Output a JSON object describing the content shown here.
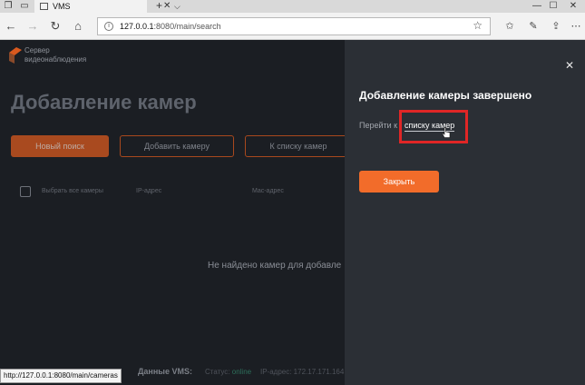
{
  "browser": {
    "tab_title": "VMS",
    "url_host": "127.0.0.1",
    "url_rest": ":8080/main/search",
    "status_url": "http://127.0.0.1:8080/main/cameras"
  },
  "app": {
    "logo_line1": "Сервер",
    "logo_line2": "видеонаблюдения",
    "page_title": "Добавление камер",
    "buttons": {
      "new_search": "Новый поиск",
      "add_camera": "Добавить камеру",
      "to_list": "К списку камер"
    },
    "table": {
      "select_all": "Выбрать все камеры",
      "col_ip": "IP-адрес",
      "col_mac": "Mac-адрес"
    },
    "empty_message": "Не найдено камер для добавле",
    "footer": {
      "label": "Данные VMS:",
      "status_label": "Статус:",
      "status_value": "online",
      "ip": "IP-адрес: 172.17.171.164"
    }
  },
  "dialog": {
    "title": "Добавление камеры завершено",
    "goto_text": "Перейти к",
    "goto_link": "списку камер",
    "close_button": "Закрыть"
  },
  "colors": {
    "accent": "#f26c2a",
    "panel_bg": "#2b2f35",
    "page_bg": "#1b1e23",
    "highlight": "#e02626"
  },
  "icons": [
    "tab-list-icon",
    "back-icon",
    "forward-icon",
    "refresh-icon",
    "home-icon",
    "lock-icon",
    "star-icon",
    "favorites-icon",
    "pen-icon",
    "share-icon",
    "more-icon",
    "close-icon",
    "cursor-hand-icon"
  ]
}
